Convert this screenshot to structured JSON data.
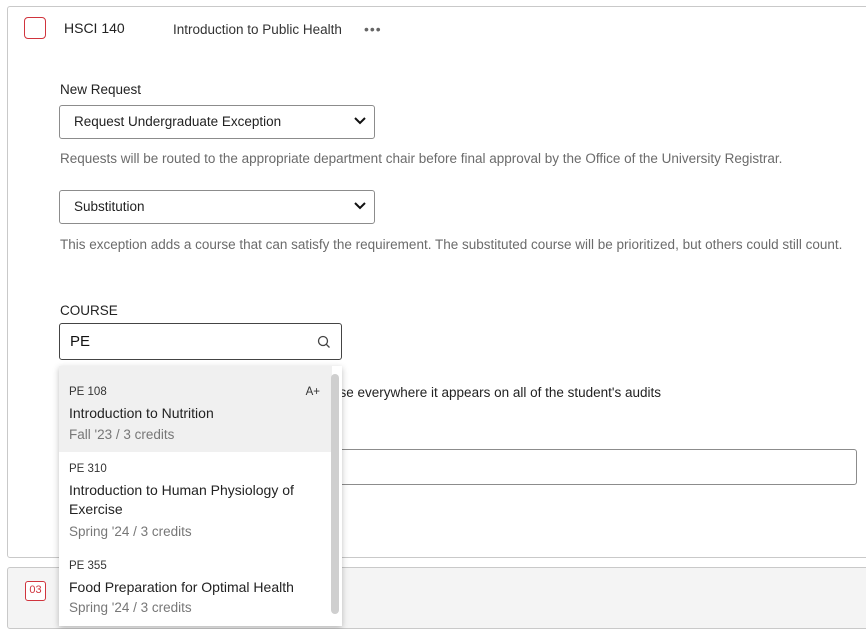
{
  "course": {
    "code": "HSCI 140",
    "title": "Introduction to Public Health",
    "more": "•••"
  },
  "request": {
    "label": "New Request",
    "type_value": "Request Undergraduate Exception",
    "routing_help": "Requests will be routed to the appropriate department chair before final approval by the Office of the University Registrar.",
    "exception_value": "Substitution",
    "exception_help": "This exception adds a course that can satisfy the requirement. The substituted course will be prioritized, but others could still count."
  },
  "course_search": {
    "label": "COURSE",
    "value": "PE",
    "partial_text": "rse everywhere it appears on all of the student's audits"
  },
  "results": [
    {
      "code": "PE 108",
      "name": "Introduction to Nutrition",
      "meta": "Fall '23 / 3 credits",
      "grade": "A+"
    },
    {
      "code": "PE 310",
      "name": "Introduction to Human Physiology of Exercise",
      "meta": "Spring '24 / 3 credits"
    },
    {
      "code": "PE 355",
      "name": "Food Preparation for Optimal Health",
      "meta": "Spring '24 / 3 credits"
    }
  ],
  "next_card": {
    "number": "03"
  },
  "colors": {
    "accent": "#d0343d",
    "highlight": "#f0f0f0",
    "muted": "#6b6b6b"
  }
}
